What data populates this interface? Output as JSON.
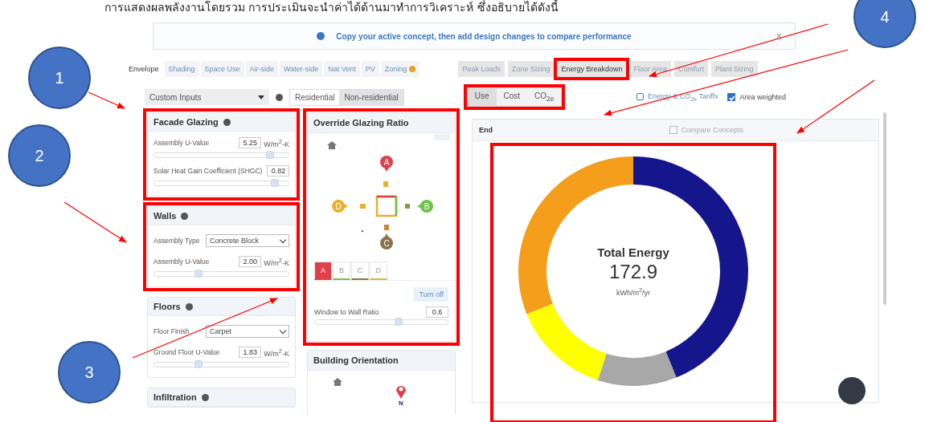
{
  "caption": "การแสดงผลพลังงานโดยรวม การประเมินจะนำค่าได้ด้านมาทำการวิเคราะห์ ซึ่งอธิบายได้ดังนี้",
  "banner": {
    "text": "Copy your active concept, then add design changes to compare performance",
    "close": "×"
  },
  "tabs_left": [
    {
      "label": "Envelope",
      "selected": true
    },
    {
      "label": "Shading",
      "selected": false
    },
    {
      "label": "Space Use",
      "selected": false
    },
    {
      "label": "Air-side",
      "selected": false
    },
    {
      "label": "Water-side",
      "selected": false
    },
    {
      "label": "Nat Vent",
      "selected": false
    },
    {
      "label": "PV",
      "selected": false
    },
    {
      "label": "Zoning",
      "selected": false,
      "warning": true
    }
  ],
  "tabs_right": [
    {
      "label": "Peak Loads",
      "selected": false
    },
    {
      "label": "Zone Sizing",
      "selected": false
    },
    {
      "label": "Energy Breakdown",
      "selected": true
    },
    {
      "label": "Floor Area",
      "selected": false
    },
    {
      "label": "Comfort",
      "selected": false
    },
    {
      "label": "Plant Sizing",
      "selected": false
    }
  ],
  "preset": {
    "value": "Custom Inputs"
  },
  "building_type": [
    {
      "label": "Residential",
      "selected": false
    },
    {
      "label": "Non-residential",
      "selected": true
    }
  ],
  "metric": [
    {
      "label": "Use",
      "selected": true
    },
    {
      "label": "Cost",
      "selected": false
    },
    {
      "label": "CO$_{2e}$",
      "selected": false
    }
  ],
  "tariffs_link": "Energy & CO$_{2e}$ Tariffs",
  "area_weighted": {
    "label": "Area weighted",
    "checked": true
  },
  "panels": [
    {
      "title": "Facade Glazing",
      "fields": [
        {
          "kind": "slider",
          "label": "Assembly U-Value",
          "value": "5.25",
          "unit": "W/m$^{2}$-K",
          "level": 0.86
        },
        {
          "kind": "slider",
          "label": "Solar Heat Gain Coefficient (SHGC)",
          "value": "0.82",
          "level": 0.9
        }
      ]
    },
    {
      "title": "Walls",
      "fields": [
        {
          "kind": "select",
          "label": "Assembly Type",
          "value": "Concrete Block"
        },
        {
          "kind": "slider",
          "label": "Assembly U-Value",
          "value": "2.00",
          "unit": "W/m$^{2}$-K",
          "level": 0.33
        }
      ]
    },
    {
      "title": "Floors",
      "fields": [
        {
          "kind": "select",
          "label": "Floor Finish",
          "value": "Carpet"
        },
        {
          "kind": "slider",
          "label": "Ground Floor U-Value",
          "value": "1.83",
          "unit": "W/m$^{2}$-K",
          "level": 0.33
        }
      ]
    },
    {
      "title": "Infiltration"
    }
  ],
  "glazing": {
    "title": "Override Glazing Ratio",
    "markers": [
      "A",
      "B",
      "C",
      "D"
    ],
    "facades": [
      {
        "label": "A",
        "selected": true
      },
      {
        "label": "B",
        "selected": false
      },
      {
        "label": "C",
        "selected": false
      },
      {
        "label": "D",
        "selected": false
      }
    ],
    "turn_off": "Turn off",
    "ratio": {
      "label": "Window to Wall Ratio",
      "value": "0.6",
      "level": 0.63
    }
  },
  "orientation": {
    "title": "Building Orientation",
    "north": "N"
  },
  "results": {
    "title": "End",
    "compare": {
      "label": "Compare Concepts",
      "checked": false
    },
    "center_title": "Total Energy",
    "center_value": "172.9",
    "center_unit": "kWh/m$^{2}$/yr"
  },
  "callouts": [
    "1",
    "2",
    "3",
    "4"
  ]
}
